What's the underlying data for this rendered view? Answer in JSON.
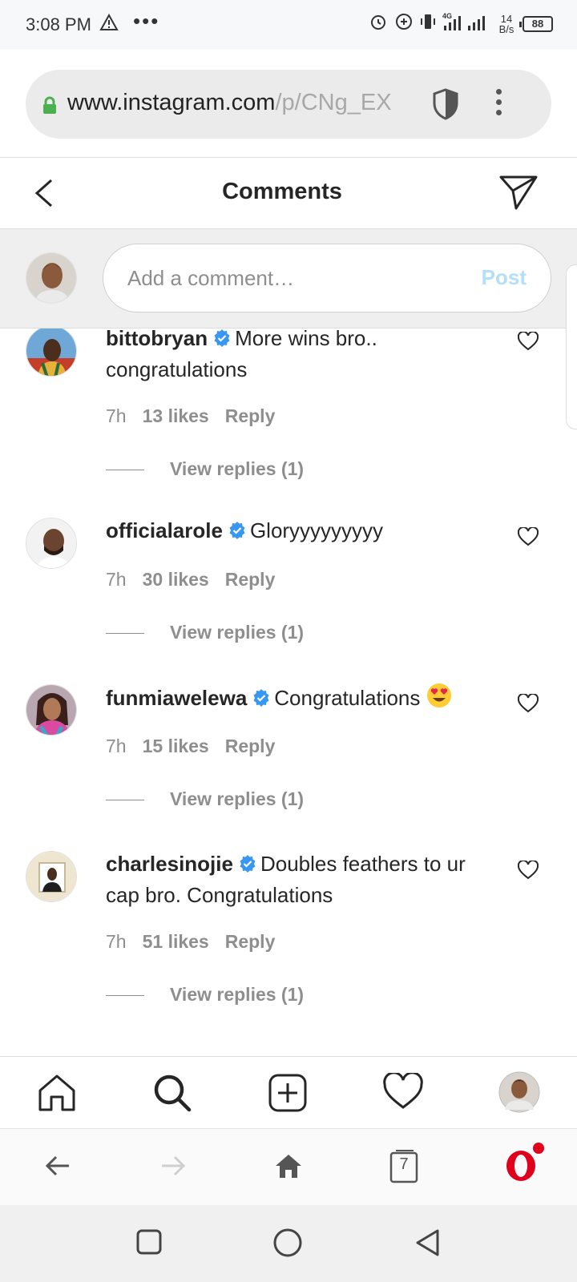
{
  "status_bar": {
    "time": "3:08 PM",
    "more_dots": "•••",
    "network_type": "4G",
    "speed_value": "14",
    "speed_unit": "B/s",
    "battery": "88"
  },
  "browser": {
    "url_domain": "www.instagram.com",
    "url_path": "/p/CNg_EX"
  },
  "header": {
    "title": "Comments"
  },
  "composer": {
    "placeholder": "Add a comment…",
    "post_label": "Post"
  },
  "comments": [
    {
      "username": "bittobryan",
      "text": "More wins bro.. congratulations",
      "time": "7h",
      "likes": "13 likes",
      "reply_label": "Reply",
      "view_replies": "View replies (1)"
    },
    {
      "username": "officialarole",
      "text": "Gloryyyyyyyyy",
      "time": "7h",
      "likes": "30 likes",
      "reply_label": "Reply",
      "view_replies": "View replies (1)"
    },
    {
      "username": "funmiawelewa",
      "text": "Congratulations",
      "time": "7h",
      "likes": "15 likes",
      "reply_label": "Reply",
      "view_replies": "View replies (1)"
    },
    {
      "username": "charlesinojie",
      "text": "Doubles feathers to ur cap bro. Congratulations",
      "time": "7h",
      "likes": "51 likes",
      "reply_label": "Reply",
      "view_replies": "View replies (1)"
    }
  ],
  "browser_nav": {
    "tabs_count": "7"
  },
  "colors": {
    "accent_blue": "#3897f0",
    "post_disabled": "#b2dffc",
    "opera_red": "#e0001b",
    "verified_blue": "#3897f0",
    "lock_green": "#4caf50"
  },
  "icons": [
    "warning-icon",
    "alarm-icon",
    "signal-icon",
    "lock-icon",
    "shield-icon",
    "menu-icon",
    "back-icon",
    "send-icon",
    "verified-icon",
    "heart-icon",
    "heart-eyes-emoji-icon",
    "home-icon",
    "search-icon",
    "new-post-icon",
    "activity-icon",
    "profile-icon",
    "browser-back-icon",
    "browser-forward-icon",
    "browser-home-icon",
    "tabs-icon",
    "opera-icon",
    "android-recents-icon",
    "android-home-icon",
    "android-back-icon"
  ]
}
